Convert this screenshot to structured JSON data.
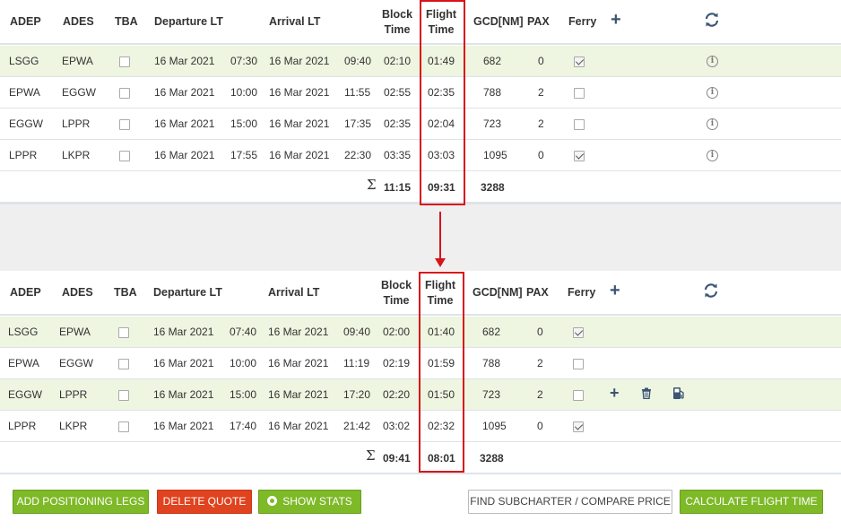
{
  "headers": {
    "adep": "ADEP",
    "ades": "ADES",
    "tba": "TBA",
    "departure": "Departure LT",
    "arrival": "Arrival LT",
    "block_1": "Block",
    "block_2": "Time",
    "flight_1": "Flight",
    "flight_2": "Time",
    "gcd": "GCD[NM]",
    "pax": "PAX",
    "ferry": "Ferry",
    "add": "+"
  },
  "top": {
    "rows": [
      {
        "adep": "LSGG",
        "ades": "EPWA",
        "tba": false,
        "dep_date": "16 Mar 2021",
        "dep_time": "07:30",
        "arr_date": "16 Mar 2021",
        "arr_time": "09:40",
        "block": "02:10",
        "flight": "01:49",
        "gcd": "682",
        "pax": "0",
        "ferry": true
      },
      {
        "adep": "EPWA",
        "ades": "EGGW",
        "tba": false,
        "dep_date": "16 Mar 2021",
        "dep_time": "10:00",
        "arr_date": "16 Mar 2021",
        "arr_time": "11:55",
        "block": "02:55",
        "flight": "02:35",
        "gcd": "788",
        "pax": "2",
        "ferry": false
      },
      {
        "adep": "EGGW",
        "ades": "LPPR",
        "tba": false,
        "dep_date": "16 Mar 2021",
        "dep_time": "15:00",
        "arr_date": "16 Mar 2021",
        "arr_time": "17:35",
        "block": "02:35",
        "flight": "02:04",
        "gcd": "723",
        "pax": "2",
        "ferry": false
      },
      {
        "adep": "LPPR",
        "ades": "LKPR",
        "tba": false,
        "dep_date": "16 Mar 2021",
        "dep_time": "17:55",
        "arr_date": "16 Mar 2021",
        "arr_time": "22:30",
        "block": "03:35",
        "flight": "03:03",
        "gcd": "1095",
        "pax": "0",
        "ferry": true
      }
    ],
    "totals": {
      "sigma": "Σ",
      "block": "11:15",
      "flight": "09:31",
      "gcd": "3288"
    }
  },
  "bottom": {
    "rows": [
      {
        "adep": "LSGG",
        "ades": "EPWA",
        "tba": false,
        "dep_date": "16 Mar 2021",
        "dep_time": "07:40",
        "arr_date": "16 Mar 2021",
        "arr_time": "09:40",
        "block": "02:00",
        "flight": "01:40",
        "gcd": "682",
        "pax": "0",
        "ferry": true
      },
      {
        "adep": "EPWA",
        "ades": "EGGW",
        "tba": false,
        "dep_date": "16 Mar 2021",
        "dep_time": "10:00",
        "arr_date": "16 Mar 2021",
        "arr_time": "11:19",
        "block": "02:19",
        "flight": "01:59",
        "gcd": "788",
        "pax": "2",
        "ferry": false
      },
      {
        "adep": "EGGW",
        "ades": "LPPR",
        "tba": false,
        "dep_date": "16 Mar 2021",
        "dep_time": "15:00",
        "arr_date": "16 Mar 2021",
        "arr_time": "17:20",
        "block": "02:20",
        "flight": "01:50",
        "gcd": "723",
        "pax": "2",
        "ferry": false
      },
      {
        "adep": "LPPR",
        "ades": "LKPR",
        "tba": false,
        "dep_date": "16 Mar 2021",
        "dep_time": "17:40",
        "arr_date": "16 Mar 2021",
        "arr_time": "21:42",
        "block": "03:02",
        "flight": "02:32",
        "gcd": "1095",
        "pax": "0",
        "ferry": true
      }
    ],
    "totals": {
      "sigma": "Σ",
      "block": "09:41",
      "flight": "08:01",
      "gcd": "3288"
    }
  },
  "buttons": {
    "add_positioning": "ADD POSITIONING LEGS",
    "delete_quote": "DELETE QUOTE",
    "show_stats": "SHOW STATS",
    "find_subcharter": "FIND SUBCHARTER / COMPARE PRICE",
    "calculate": "CALCULATE FLIGHT TIME"
  },
  "icons": [
    "plus-icon",
    "refresh-icon",
    "info-icon",
    "trash-icon",
    "fuel-icon"
  ],
  "colors": {
    "highlight_row": "#eef5e0",
    "accent_green": "#7eb928",
    "danger_red": "#e0431f",
    "annotation_red": "#d8131a",
    "icon_navy": "#3b5575"
  }
}
